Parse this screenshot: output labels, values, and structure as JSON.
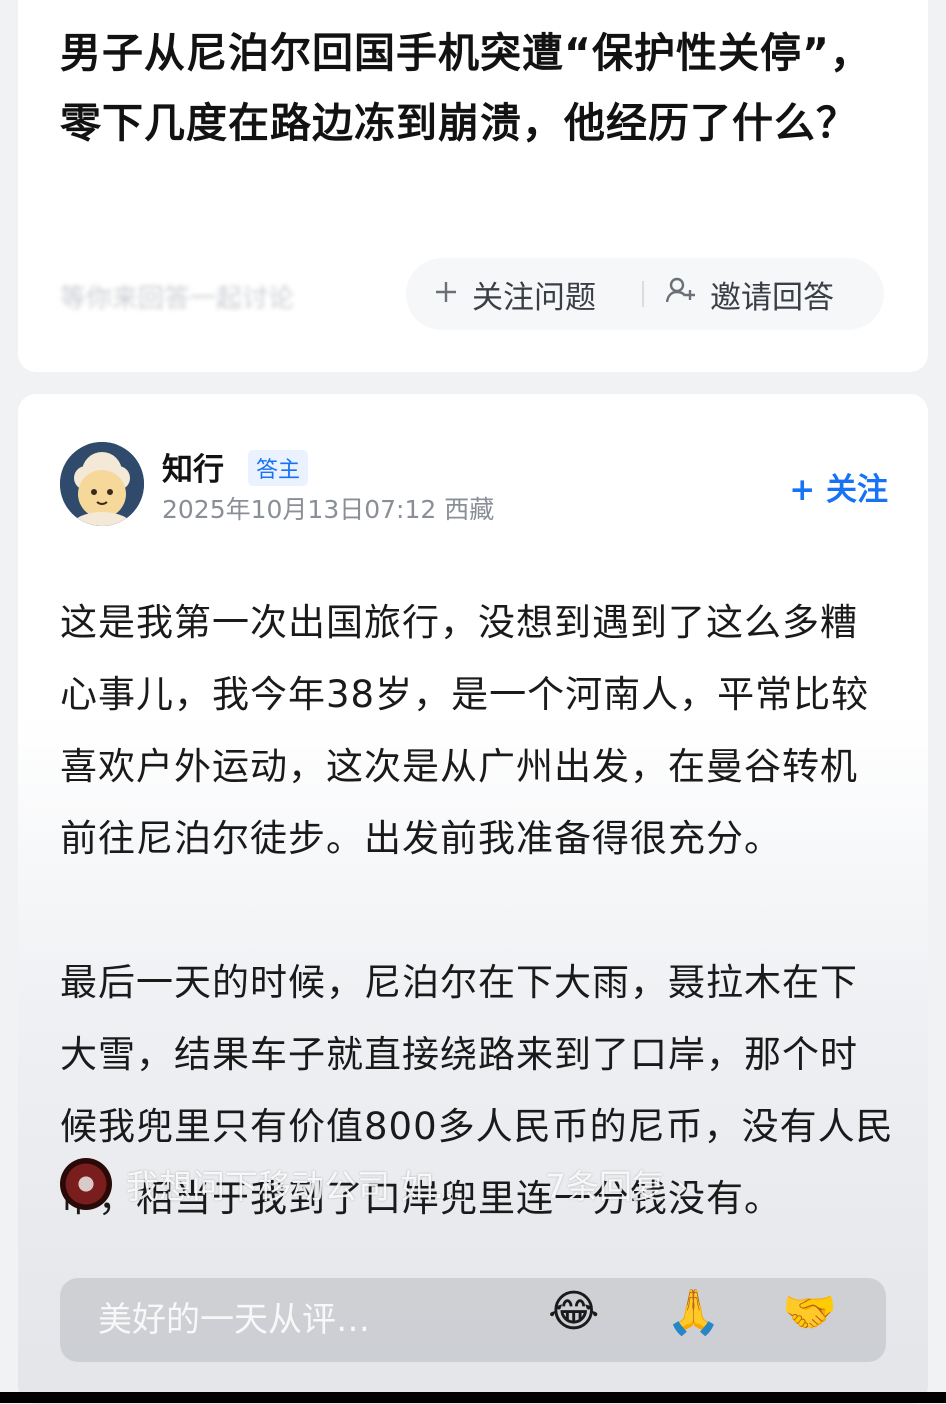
{
  "question": {
    "title": "男子从尼泊尔回国手机突遭“保护性关停”，零下几度在路边冻到崩溃，他经历了什么？",
    "meta": "等你来回答一起讨论",
    "follow_label": "关注问题",
    "invite_label": "邀请回答"
  },
  "answer": {
    "author_name": "知行",
    "author_badge": "答主",
    "date": "2025年10月13日07:12",
    "location": "西藏",
    "follow_label": "+ 关注",
    "paragraphs": [
      "这是我第一次出国旅行，没想到遇到了这么多糟心事儿，我今年38岁，是一个河南人，平常比较喜欢户外运动，这次是从广州出发，在曼谷转机前往尼泊尔徒步。出发前我准备得很充分。",
      "最后一天的时候，尼泊尔在下大雨，聂拉木在下大雪，结果车子就直接绕路来到了口岸，那个时候我兜里只有价值800多人民币的尼币，没有人民币，相当于我到了口岸兜里连一分钱没有。"
    ]
  },
  "overlay": {
    "danmaku_text": "我想问下移动公司 如...",
    "reply_count": "7条回复 ›",
    "comment_placeholder": "美好的一天从评…",
    "emojis": [
      "😂",
      "🙏",
      "🤝"
    ]
  }
}
